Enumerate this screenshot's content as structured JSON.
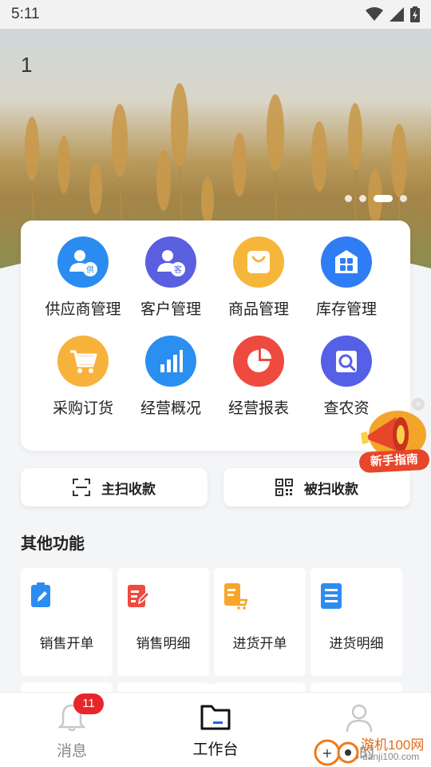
{
  "status_bar": {
    "time": "5:11"
  },
  "banner": {
    "index": "1"
  },
  "main_grid": [
    {
      "label": "供应商管理",
      "icon": "supplier-icon",
      "color": "#2a8cf0"
    },
    {
      "label": "客户管理",
      "icon": "customer-icon",
      "color": "#5a5fe0"
    },
    {
      "label": "商品管理",
      "icon": "product-bag-icon",
      "color": "#f6b63a"
    },
    {
      "label": "库存管理",
      "icon": "inventory-icon",
      "color": "#2f7df5"
    },
    {
      "label": "采购订货",
      "icon": "shopping-cart-icon",
      "color": "#f7b23b"
    },
    {
      "label": "经营概况",
      "icon": "bar-chart-icon",
      "color": "#2a8ff0"
    },
    {
      "label": "经营报表",
      "icon": "pie-chart-icon",
      "color": "#ef4a3f"
    },
    {
      "label": "查农资",
      "icon": "search-document-icon",
      "color": "#5560e6"
    }
  ],
  "guide": {
    "label": "新手指南",
    "close": "×"
  },
  "scan": {
    "main": "主扫收款",
    "passive": "被扫收款"
  },
  "section": {
    "title": "其他功能"
  },
  "functions": [
    {
      "label": "销售开单",
      "icon": "edit-document-icon",
      "color": "#2d8cf0"
    },
    {
      "label": "销售明细",
      "icon": "list-edit-icon",
      "color": "#ef4a3f"
    },
    {
      "label": "进货开单",
      "icon": "cart-document-icon",
      "color": "#f7a52b"
    },
    {
      "label": "进货明细",
      "icon": "list-document-icon",
      "color": "#2d8cf0"
    }
  ],
  "tabbar": {
    "messages": "消息",
    "messages_badge": "11",
    "workbench": "工作台",
    "profile": "我的"
  },
  "watermark": {
    "text": "游机100网",
    "url": "danji100.com"
  }
}
